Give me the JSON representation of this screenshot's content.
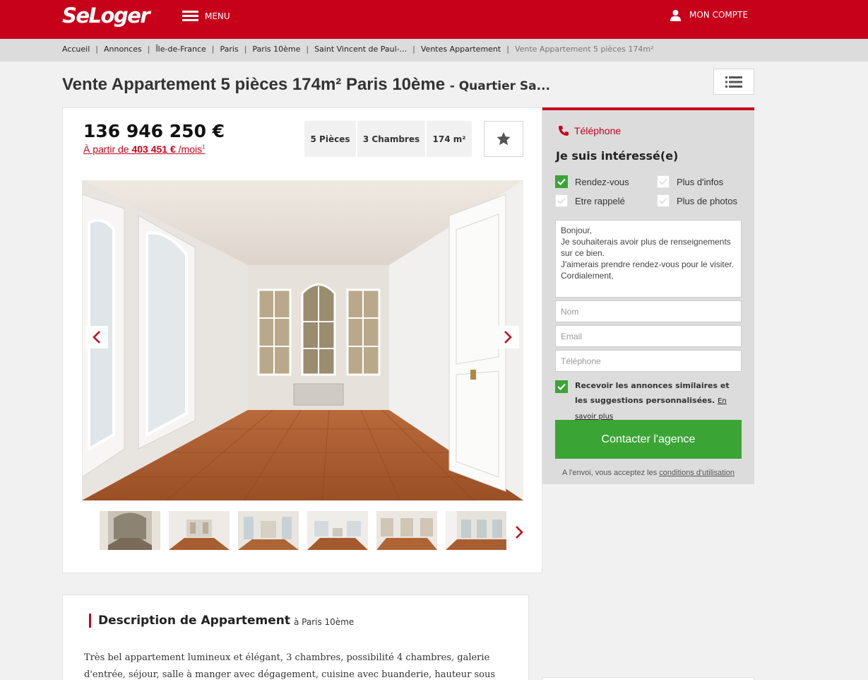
{
  "header": {
    "logo": "SeLoger",
    "menu_label": "MENU",
    "account_label": "MON COMPTE"
  },
  "breadcrumb": [
    {
      "label": "Accueil"
    },
    {
      "label": "Annonces"
    },
    {
      "label": "Île-de-France"
    },
    {
      "label": "Paris"
    },
    {
      "label": "Paris 10ème"
    },
    {
      "label": "Saint Vincent de Paul-..."
    },
    {
      "label": "Ventes Appartement"
    },
    {
      "label": "Vente Appartement 5 pièces 174m²"
    }
  ],
  "listing": {
    "title": "Vente Appartement 5 pièces 174m² Paris 10ème",
    "subtitle": "- Quartier Sa...",
    "price": "136 946 250 €",
    "monthly_prefix": "À partir de",
    "monthly_amount": "403 451 €",
    "monthly_suffix": "/mois",
    "monthly_note": "1",
    "features": [
      "5 Pièces",
      "3 Chambres",
      "174 m²"
    ]
  },
  "description": {
    "title": "Description de Appartement",
    "location": "à Paris 10ème",
    "text": "Très bel appartement lumineux et élégant, 3 chambres, possibilité 4 chambres, galerie d'entrée, séjour, salle à manger avec dégagement, cuisine avec buanderie, hauteur sous"
  },
  "contact": {
    "phone_label": "Téléphone",
    "heading": "Je suis intéressé(e)",
    "options": [
      {
        "label": "Rendez-vous",
        "checked": true
      },
      {
        "label": "Plus d'infos",
        "checked": false
      },
      {
        "label": "Etre rappelé",
        "checked": false
      },
      {
        "label": "Plus de photos",
        "checked": false
      }
    ],
    "message": "Bonjour,\nJe souhaiterais avoir plus de renseignements sur ce bien.\nJ'aimerais prendre rendez-vous pour le visiter.\nCordialement,",
    "name_placeholder": "Nom",
    "email_placeholder": "Email",
    "phone_placeholder": "Téléphone",
    "optin_text": "Recevoir les annonces similaires et les suggestions personnalisées.",
    "optin_link": "En savoir plus",
    "submit_label": "Contacter l'agence",
    "terms_prefix": "A l'envoi, vous acceptez les",
    "terms_link": "conditions d'utilisation"
  },
  "colors": {
    "brand_red": "#c8011b",
    "cta_green": "#3aa535"
  },
  "icons": [
    "menu-icon",
    "user-icon",
    "list-icon",
    "star-icon",
    "chevron-left-icon",
    "chevron-right-icon",
    "phone-icon",
    "check-icon"
  ]
}
